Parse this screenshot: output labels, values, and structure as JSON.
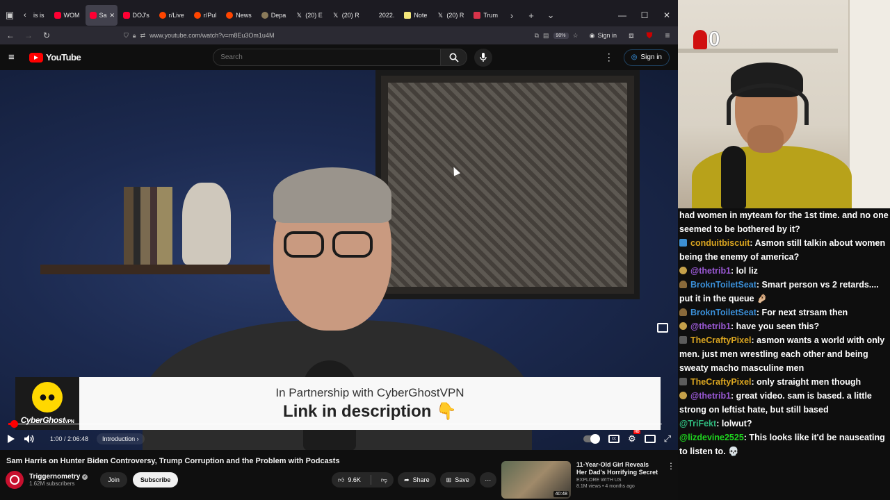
{
  "browser": {
    "tabs": [
      {
        "label": "is is",
        "favicon": "back-arrow"
      },
      {
        "label": "WOM",
        "favicon": "youtube"
      },
      {
        "label": "Sa",
        "favicon": "youtube",
        "active": true
      },
      {
        "label": "DOJ's",
        "favicon": "youtube"
      },
      {
        "label": "r/Live",
        "favicon": "reddit"
      },
      {
        "label": "r/Pul",
        "favicon": "reddit"
      },
      {
        "label": "News",
        "favicon": "reddit"
      },
      {
        "label": "Depa",
        "favicon": "globe"
      },
      {
        "label": "(20) E",
        "favicon": "x"
      },
      {
        "label": "(20) R",
        "favicon": "x"
      },
      {
        "label": "2022.",
        "favicon": "blank"
      },
      {
        "label": "Note",
        "favicon": "note"
      },
      {
        "label": "(20) R",
        "favicon": "x"
      },
      {
        "label": "Trum",
        "favicon": "trump"
      }
    ],
    "url": "www.youtube.com/watch?v=m8Eu3Om1u4M",
    "zoom": "90%",
    "signin_label": "Sign in",
    "extension_badge": "15"
  },
  "youtube": {
    "logo_text": "YouTube",
    "search_placeholder": "Search",
    "signin_label": "Sign in"
  },
  "video": {
    "sponsor_brand": "CyberGhost",
    "sponsor_brand_suffix": "VPN",
    "sponsor_line1": "In Partnership with CyberGhostVPN",
    "sponsor_line2": "Link in description",
    "sponsor_emoji": "👇",
    "time_current": "1:00",
    "time_total": "2:06:48",
    "time_display": "1:00 / 2:06:48",
    "chapter": "Introduction",
    "progress_fraction": 0.008
  },
  "info": {
    "title": "Sam Harris on Hunter Biden Controversy, Trump Corruption and the Problem with Podcasts",
    "channel": "Triggernometry",
    "subscribers": "1.62M subscribers",
    "join_label": "Join",
    "subscribe_label": "Subscribe",
    "likes": "9.6K",
    "share_label": "Share",
    "save_label": "Save"
  },
  "recommendation": {
    "title": "11-Year-Old Girl Reveals Her Dad's Horrifying Secret",
    "channel": "EXPLORE WITH US",
    "meta": "8.1M views • 4 months ago",
    "duration": "40:48"
  },
  "stream": {
    "viewer_counter": "0"
  },
  "chat": [
    {
      "badge": "",
      "user": "",
      "color": "#ffffff",
      "text": "had women in myteam for the 1st time. and no one seemed to be bothered by it?"
    },
    {
      "badge": "sub",
      "user": "conduitbiscuit",
      "color": "#daa520",
      "text": ": Asmon still talkin about women being the enemy of america?"
    },
    {
      "badge": "prime",
      "user": "@thetrib1",
      "color": "#9b59d6",
      "text": ": lol liz"
    },
    {
      "badge": "person",
      "user": "BroknToiletSeat",
      "color": "#3a8fd8",
      "text": ": Smart person vs 2 retards.... put it in the queue 🤌🏼"
    },
    {
      "badge": "person",
      "user": "BroknToiletSeat",
      "color": "#3a8fd8",
      "text": ": For next strsam then"
    },
    {
      "badge": "prime",
      "user": "@thetrib1",
      "color": "#9b59d6",
      "text": ": have you seen this?"
    },
    {
      "badge": "game",
      "user": "TheCraftyPixel",
      "color": "#daa520",
      "text": ": asmon wants a world with only men. just men wrestling each other and being sweaty macho masculine men"
    },
    {
      "badge": "game",
      "user": "TheCraftyPixel",
      "color": "#daa520",
      "text": ": only straight men though"
    },
    {
      "badge": "prime",
      "user": "@thetrib1",
      "color": "#9b59d6",
      "text": ": great video. sam is based. a little strong on leftist hate, but still based"
    },
    {
      "badge": "",
      "user": "@TriFekt",
      "color": "#2fb67c",
      "text": ": lolwut?"
    },
    {
      "badge": "",
      "user": "@lizdevine2525",
      "color": "#1fd61f",
      "text": ": This looks like it'd be nauseating to listen to. 💀"
    }
  ],
  "colors": {
    "yt_red": "#ff0000",
    "link_blue": "#3ea6ff",
    "background": "#0f0f0f"
  }
}
